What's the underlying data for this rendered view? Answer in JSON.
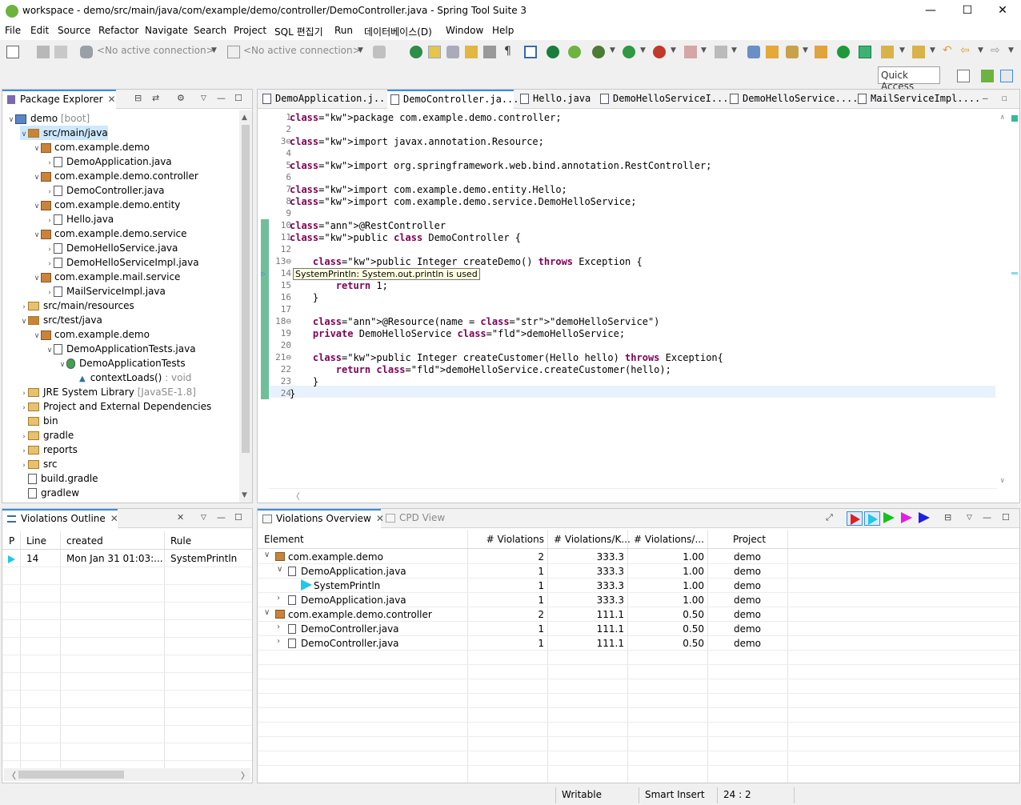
{
  "window": {
    "title": "workspace - demo/src/main/java/com/example/demo/controller/DemoController.java - Spring Tool Suite 3"
  },
  "menu": [
    "File",
    "Edit",
    "Source",
    "Refactor",
    "Navigate",
    "Search",
    "Project",
    "SQL 편집기",
    "Run",
    "데이터베이스(D)",
    "Window",
    "Help"
  ],
  "toolbar": {
    "connection_placeholder": "<No active connection>",
    "connection_placeholder2": "<No active connection>",
    "quick_access": "Quick Access"
  },
  "package_explorer": {
    "tab": "Package Explorer",
    "tree": [
      {
        "label": "demo",
        "suffix": " [boot]",
        "level": 0,
        "expanded": true,
        "kind": "project"
      },
      {
        "label": "src/main/java",
        "level": 1,
        "expanded": true,
        "kind": "srcfolder",
        "selected": true
      },
      {
        "label": "com.example.demo",
        "level": 2,
        "expanded": true,
        "kind": "package"
      },
      {
        "label": "DemoApplication.java",
        "level": 3,
        "expanded": false,
        "kind": "java"
      },
      {
        "label": "com.example.demo.controller",
        "level": 2,
        "expanded": true,
        "kind": "package"
      },
      {
        "label": "DemoController.java",
        "level": 3,
        "expanded": false,
        "kind": "java"
      },
      {
        "label": "com.example.demo.entity",
        "level": 2,
        "expanded": true,
        "kind": "package"
      },
      {
        "label": "Hello.java",
        "level": 3,
        "expanded": false,
        "kind": "java"
      },
      {
        "label": "com.example.demo.service",
        "level": 2,
        "expanded": true,
        "kind": "package"
      },
      {
        "label": "DemoHelloService.java",
        "level": 3,
        "expanded": false,
        "kind": "java"
      },
      {
        "label": "DemoHelloServiceImpl.java",
        "level": 3,
        "expanded": false,
        "kind": "java"
      },
      {
        "label": "com.example.mail.service",
        "level": 2,
        "expanded": true,
        "kind": "package"
      },
      {
        "label": "MailServiceImpl.java",
        "level": 3,
        "expanded": false,
        "kind": "java"
      },
      {
        "label": "src/main/resources",
        "level": 1,
        "expanded": false,
        "kind": "folder"
      },
      {
        "label": "src/test/java",
        "level": 1,
        "expanded": true,
        "kind": "srcfolder"
      },
      {
        "label": "com.example.demo",
        "level": 2,
        "expanded": true,
        "kind": "package"
      },
      {
        "label": "DemoApplicationTests.java",
        "level": 3,
        "expanded": true,
        "kind": "java"
      },
      {
        "label": "DemoApplicationTests",
        "level": 4,
        "expanded": true,
        "kind": "class"
      },
      {
        "label": "contextLoads()",
        "suffix": " : void",
        "level": 5,
        "kind": "method"
      },
      {
        "label": "JRE System Library",
        "suffix": " [JavaSE-1.8]",
        "level": 1,
        "expanded": false,
        "kind": "library"
      },
      {
        "label": "Project and External Dependencies",
        "level": 1,
        "expanded": false,
        "kind": "library"
      },
      {
        "label": "bin",
        "level": 1,
        "kind": "folder"
      },
      {
        "label": "gradle",
        "level": 1,
        "expanded": false,
        "kind": "folder"
      },
      {
        "label": "reports",
        "level": 1,
        "expanded": false,
        "kind": "folder"
      },
      {
        "label": "src",
        "level": 1,
        "expanded": false,
        "kind": "folder"
      },
      {
        "label": "build.gradle",
        "level": 1,
        "kind": "file"
      },
      {
        "label": "gradlew",
        "level": 1,
        "kind": "file"
      }
    ]
  },
  "editor": {
    "tabs": [
      "DemoApplication.j...",
      "DemoController.ja...",
      "Hello.java",
      "DemoHelloServiceI...",
      "DemoHelloService....",
      "MailServiceImpl...."
    ],
    "active_tab": 1,
    "tooltip": "SystemPrintln: System.out.println is used",
    "lines": [
      {
        "n": "1",
        "t": "package com.example.demo.controller;"
      },
      {
        "n": "2",
        "t": ""
      },
      {
        "n": "3⊖",
        "t": "import javax.annotation.Resource;"
      },
      {
        "n": "4",
        "t": ""
      },
      {
        "n": "5",
        "t": "import org.springframework.web.bind.annotation.RestController;"
      },
      {
        "n": "6",
        "t": ""
      },
      {
        "n": "7",
        "t": "import com.example.demo.entity.Hello;"
      },
      {
        "n": "8",
        "t": "import com.example.demo.service.DemoHelloService;"
      },
      {
        "n": "9",
        "t": ""
      },
      {
        "n": "10",
        "t": "@RestController"
      },
      {
        "n": "11",
        "t": "public class DemoController {"
      },
      {
        "n": "12",
        "t": ""
      },
      {
        "n": "13⊖",
        "t": "    public Integer createDemo() throws Exception {"
      },
      {
        "n": "14",
        "t": ""
      },
      {
        "n": "15",
        "t": "        return 1;"
      },
      {
        "n": "16",
        "t": "    }"
      },
      {
        "n": "17",
        "t": ""
      },
      {
        "n": "18⊖",
        "t": "    @Resource(name = \"demoHelloService\")"
      },
      {
        "n": "19",
        "t": "    private DemoHelloService demoHelloService;"
      },
      {
        "n": "20",
        "t": ""
      },
      {
        "n": "21⊖",
        "t": "    public Integer createCustomer(Hello hello) throws Exception{"
      },
      {
        "n": "22",
        "t": "        return demoHelloService.createCustomer(hello);"
      },
      {
        "n": "23",
        "t": "    }"
      },
      {
        "n": "24",
        "t": "}"
      }
    ]
  },
  "violations_outline": {
    "tab": "Violations Outline",
    "columns": [
      "P",
      "Line",
      "created",
      "Rule"
    ],
    "rows": [
      {
        "line": "14",
        "created": "Mon Jan 31 01:03:...",
        "rule": "SystemPrintln"
      }
    ]
  },
  "violations_overview": {
    "tab": "Violations Overview",
    "tab2": "CPD View",
    "columns": [
      "Element",
      "# Violations",
      "# Violations/K...",
      "# Violations/...",
      "Project"
    ],
    "rows": [
      {
        "level": 0,
        "expanded": true,
        "kind": "package",
        "element": "com.example.demo",
        "v": "2",
        "vk": "333.3",
        "vm": "1.00",
        "project": "demo"
      },
      {
        "level": 1,
        "expanded": true,
        "kind": "java",
        "element": "DemoApplication.java",
        "v": "1",
        "vk": "333.3",
        "vm": "1.00",
        "project": "demo"
      },
      {
        "level": 2,
        "kind": "rule",
        "element": "SystemPrintln",
        "v": "1",
        "vk": "333.3",
        "vm": "1.00",
        "project": "demo"
      },
      {
        "level": 1,
        "expanded": false,
        "kind": "java",
        "element": "DemoApplication.java",
        "v": "1",
        "vk": "333.3",
        "vm": "1.00",
        "project": "demo"
      },
      {
        "level": 0,
        "expanded": true,
        "kind": "package",
        "element": "com.example.demo.controller",
        "v": "2",
        "vk": "111.1",
        "vm": "0.50",
        "project": "demo"
      },
      {
        "level": 1,
        "expanded": false,
        "kind": "java",
        "element": "DemoController.java",
        "v": "1",
        "vk": "111.1",
        "vm": "0.50",
        "project": "demo"
      },
      {
        "level": 1,
        "expanded": false,
        "kind": "java",
        "element": "DemoController.java",
        "v": "1",
        "vk": "111.1",
        "vm": "0.50",
        "project": "demo"
      }
    ]
  },
  "status": {
    "writable": "Writable",
    "insert": "Smart Insert",
    "position": "24 : 2"
  },
  "colors": {
    "accent": "#3a8edd",
    "selection": "#cde8ff",
    "keyword": "#7f0055",
    "string": "#2a00ff",
    "field": "#0000c0"
  }
}
